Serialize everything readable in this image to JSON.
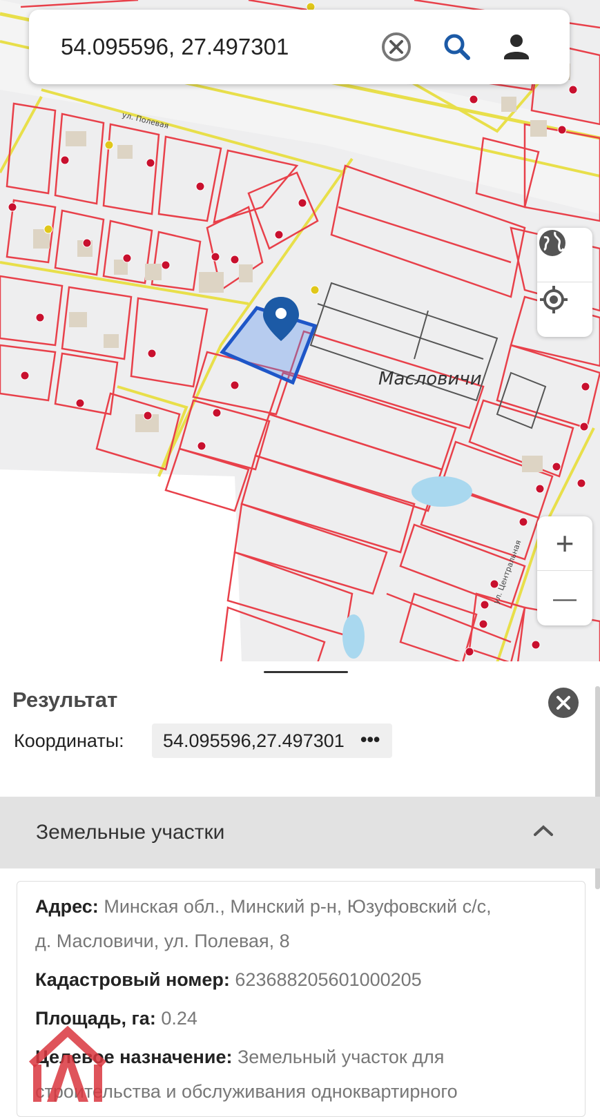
{
  "search": {
    "query": "54.095596, 27.497301",
    "clear_icon": "clear-circle-icon",
    "search_icon": "search-icon",
    "profile_icon": "person-icon"
  },
  "map": {
    "village_label": "Масловичи",
    "street_polevaya": "ул. Полевая",
    "street_central": "ул. Центральная",
    "controls": {
      "layers_icon": "globe-icon",
      "locate_icon": "crosshair-icon",
      "zoom_in": "+",
      "zoom_out": "—"
    },
    "colors": {
      "parcel_border": "#e8404a",
      "road": "#e8df4a",
      "selected": "#1e56c8",
      "water": "#a9d8ef"
    }
  },
  "result": {
    "title": "Результат",
    "coords_label": "Координаты:",
    "coords_value": "54.095596,27.497301",
    "coords_more": "•••",
    "section_title": "Земельные участки",
    "address_label": "Адрес:",
    "address_line1": "Минская обл., Минский р-н, Юзуфовский с/с,",
    "address_line2": "д. Масловичи, ул. Полевая, 8",
    "cadastral_label": "Кадастровый номер:",
    "cadastral_value": "623688205601000205",
    "area_label": "Площадь, га:",
    "area_value": "0.24",
    "purpose_label": "Целевое назначение:",
    "purpose_line1": "Земельный участок для",
    "purpose_line2": "строительства и обслуживания одноквартирного"
  }
}
